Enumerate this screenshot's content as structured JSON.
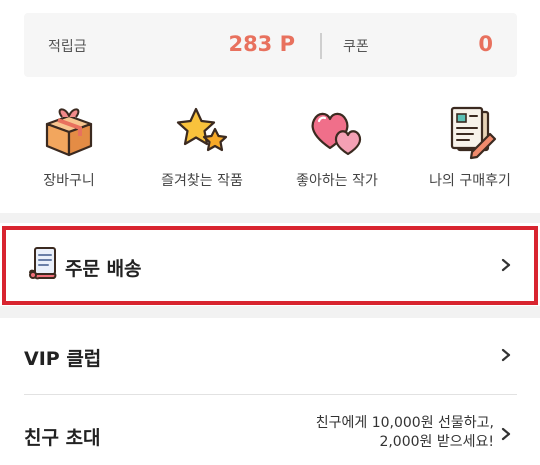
{
  "points": {
    "reward_label": "적립금",
    "reward_value": "283 P",
    "coupon_label": "쿠폰",
    "coupon_value": "0",
    "accent_color": "#e8715e"
  },
  "shortcuts": [
    {
      "label": "장바구니",
      "icon": "gift-box-icon"
    },
    {
      "label": "즐겨찾는 작품",
      "icon": "stars-icon"
    },
    {
      "label": "좋아하는 작가",
      "icon": "hearts-icon"
    },
    {
      "label": "나의 구매후기",
      "icon": "review-document-icon"
    }
  ],
  "menu": {
    "order": {
      "label": "주문 배송",
      "icon": "scroll-icon"
    },
    "vip": {
      "label": "VIP 클럽"
    },
    "invite": {
      "label": "친구 초대",
      "promo_line1": "친구에게 10,000원 선물하고,",
      "promo_line2": "2,000원 받으세요!"
    }
  },
  "highlight_color": "#d8242f"
}
